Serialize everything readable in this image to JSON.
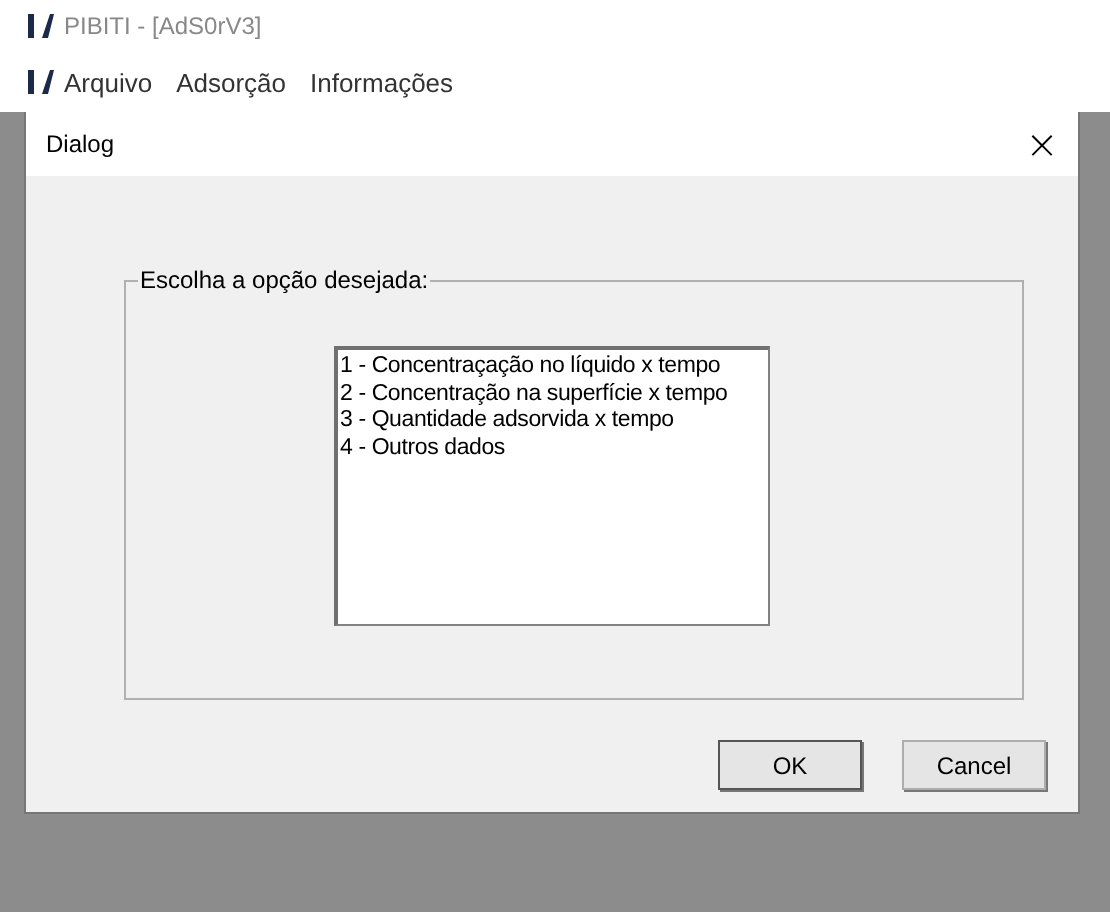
{
  "window": {
    "title": "PIBITI - [AdS0rV3]"
  },
  "menu": [
    "Arquivo",
    "Adsorção",
    "Informações"
  ],
  "dialog": {
    "title": "Dialog",
    "close": "×",
    "group_label": "Escolha a opção desejada:",
    "options": [
      {
        "label": "1 - Concentraçação no líquido x tempo",
        "selected": false
      },
      {
        "label": "2 - Concentração na superfície x tempo",
        "selected": false
      },
      {
        "label": "3 - Quantidade adsorvida x tempo",
        "selected": false
      },
      {
        "label": "4 - Outros dados",
        "selected": false
      }
    ],
    "buttons": [
      {
        "label": "OK",
        "default": true
      },
      {
        "label": "Cancel",
        "default": false
      }
    ]
  }
}
